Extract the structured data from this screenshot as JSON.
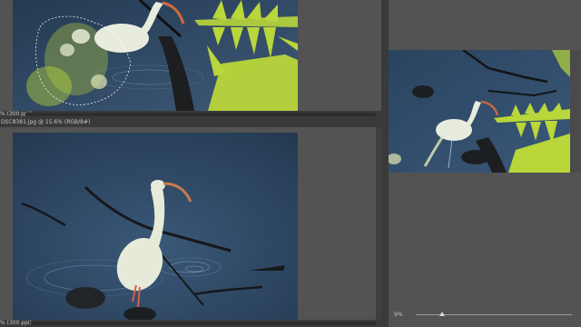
{
  "top_doc": {
    "status_label": "% (300 ppi)"
  },
  "bottom_doc": {
    "tab_label": "DSC8381.jpg @ 15.6% (RGB/8#)",
    "status_label": "% (300 ppi)"
  },
  "preview_panel": {
    "zoom_value": "9%"
  },
  "zoom_slider": {
    "level_fraction": 0.17
  },
  "colors": {
    "app_bg": "#282828",
    "doc_area_bg": "#535353",
    "water": "#2f4a66",
    "fern": "#b9d63a",
    "ibis_white": "#e8ecde",
    "beak": "#d06a3c"
  }
}
